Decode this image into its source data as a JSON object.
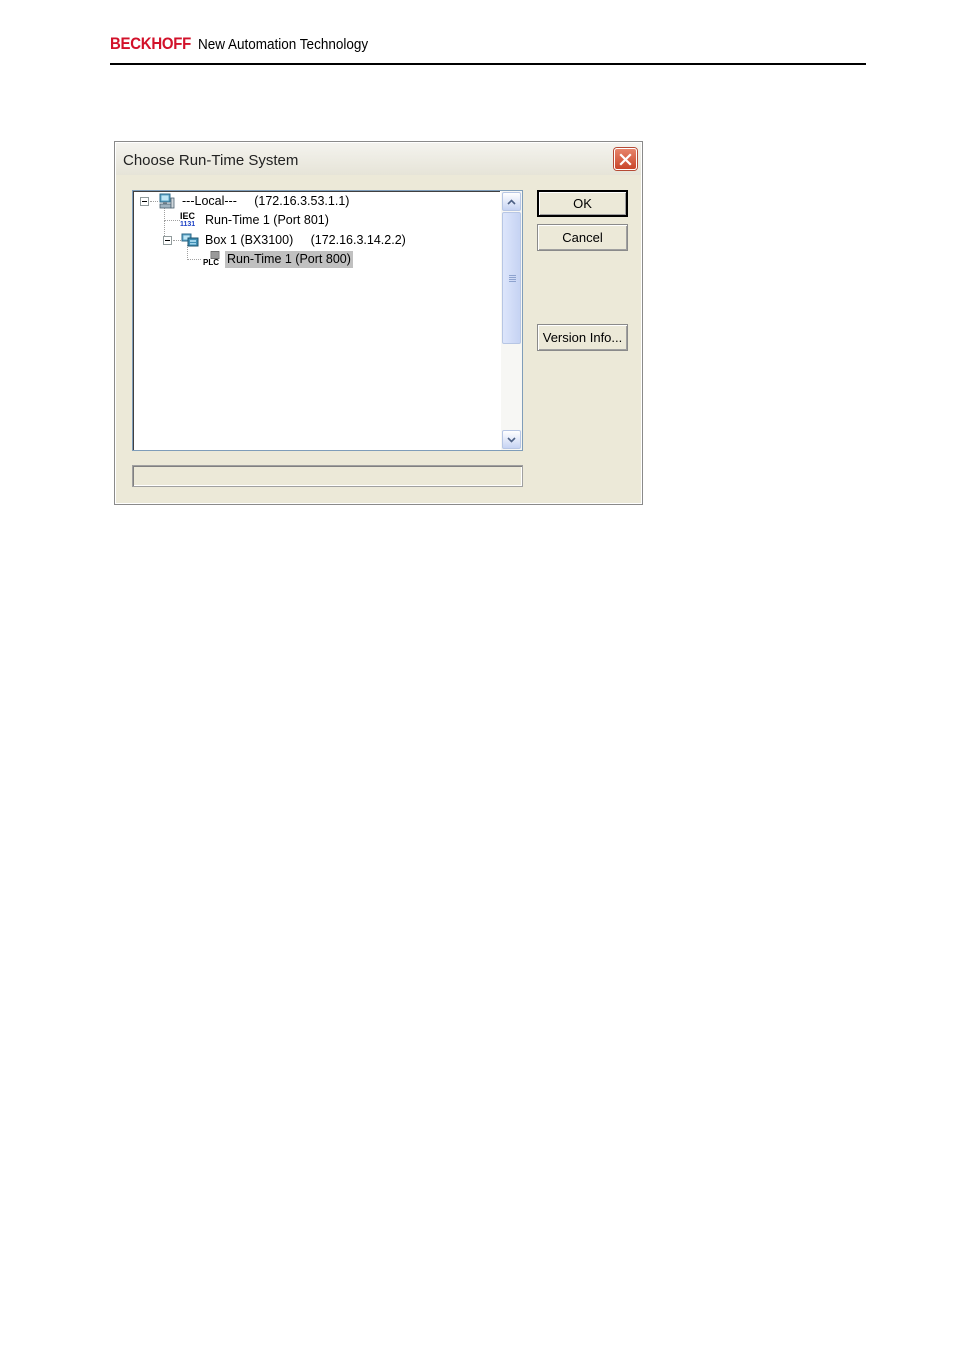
{
  "header": {
    "brand": "BECKHOFF",
    "tagline": "New Automation Technology"
  },
  "dialog": {
    "title": "Choose Run-Time System",
    "tree": [
      {
        "label": "---Local---     (172.16.3.53.1.1)",
        "icon": "computer-icon",
        "expanded": true
      },
      {
        "label": "Run-Time 1 (Port 801)",
        "icon": "iec-1131-icon"
      },
      {
        "label": "Box 1 (BX3100)     (172.16.3.14.2.2)",
        "icon": "network-box-icon",
        "expanded": true
      },
      {
        "label": "Run-Time 1 (Port 800)",
        "icon": "plc-icon",
        "selected": true
      }
    ],
    "iec_icon_top": "IEC",
    "iec_icon_bottom": "1131",
    "plc_icon_text": "PLC",
    "buttons": {
      "ok": "OK",
      "cancel": "Cancel",
      "version_info": "Version Info..."
    },
    "status_text": ""
  },
  "colors": {
    "brand": "#d2112a",
    "dialog_bg": "#ece9d8",
    "selection_bg": "#c0c0c0"
  }
}
